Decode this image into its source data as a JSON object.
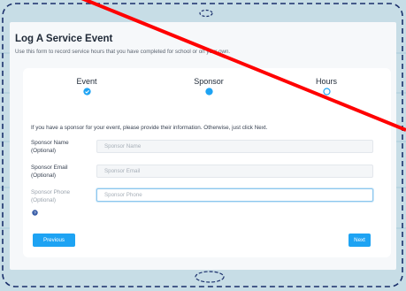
{
  "page": {
    "title": "Log A Service Event",
    "subtitle": "Use this form to record service hours that you have completed for school or on your own."
  },
  "steps": [
    {
      "label": "Event",
      "state": "completed",
      "icon": "check-circle-icon"
    },
    {
      "label": "Sponsor",
      "state": "current",
      "icon": "filled-circle-icon"
    },
    {
      "label": "Hours",
      "state": "upcoming",
      "icon": "empty-circle-icon"
    }
  ],
  "form": {
    "intro": "If you have a sponsor for your event, please provide their information. Otherwise, just click Next.",
    "fields": [
      {
        "label_line1": "Sponsor Name",
        "label_line2": "(Optional)",
        "placeholder": "Sponsor Name",
        "value": ""
      },
      {
        "label_line1": "Sponsor Email",
        "label_line2": "(Optional)",
        "placeholder": "Sponsor Email",
        "value": ""
      },
      {
        "label_line1": "Sponsor Phone",
        "label_line2": "(Optional)",
        "placeholder": "Sponsor Phone",
        "value": ""
      }
    ],
    "help_icon": "question-circle-icon",
    "previous_label": "Previous",
    "next_label": "Next"
  },
  "colors": {
    "accent": "#1ea3f3",
    "annotation_line": "#ff0000",
    "dashed_border": "#1a2f6b"
  }
}
